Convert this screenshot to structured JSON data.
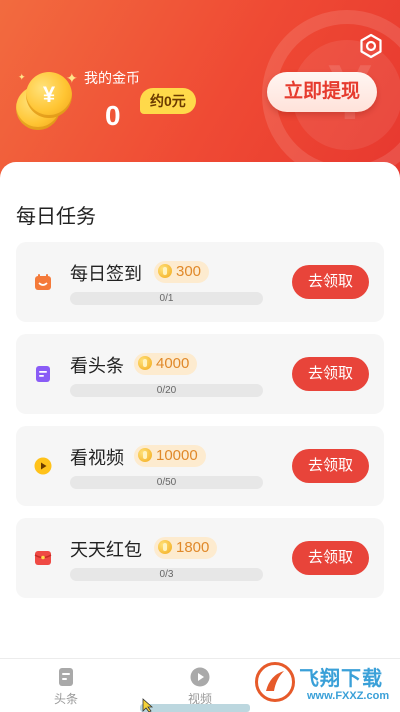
{
  "header": {
    "gold_label": "我的金币",
    "gold_value": "0",
    "approx_value": "约0元",
    "withdraw_label": "立即提现",
    "settings_icon": "gear-icon",
    "colors": {
      "gradient_start": "#f26b3f",
      "gradient_end": "#e7382f",
      "badge": "#ffd94a"
    }
  },
  "section_title": "每日任务",
  "tasks": [
    {
      "name": "每日签到",
      "reward": "300",
      "progress_text": "0/1",
      "progress": 0,
      "button": "去领取",
      "icon": "calendar-icon",
      "icon_color": "#f47a3a"
    },
    {
      "name": "看头条",
      "reward": "4000",
      "progress_text": "0/20",
      "progress": 0,
      "button": "去领取",
      "icon": "article-icon",
      "icon_color": "#8a5cf6"
    },
    {
      "name": "看视频",
      "reward": "10000",
      "progress_text": "0/50",
      "progress": 0,
      "button": "去领取",
      "icon": "play-icon",
      "icon_color": "#ffc21a"
    },
    {
      "name": "天天红包",
      "reward": "1800",
      "progress_text": "0/3",
      "progress": 0,
      "button": "去领取",
      "icon": "red-envelope-icon",
      "icon_color": "#ef4a44"
    }
  ],
  "tabbar": {
    "items": [
      {
        "label": "头条",
        "icon": "article-icon"
      },
      {
        "label": "视频",
        "icon": "play-circle-icon"
      }
    ]
  },
  "watermark": {
    "title": "飞翔下载",
    "url": "www.FXXZ.com"
  },
  "accent_color": "#e8443a"
}
